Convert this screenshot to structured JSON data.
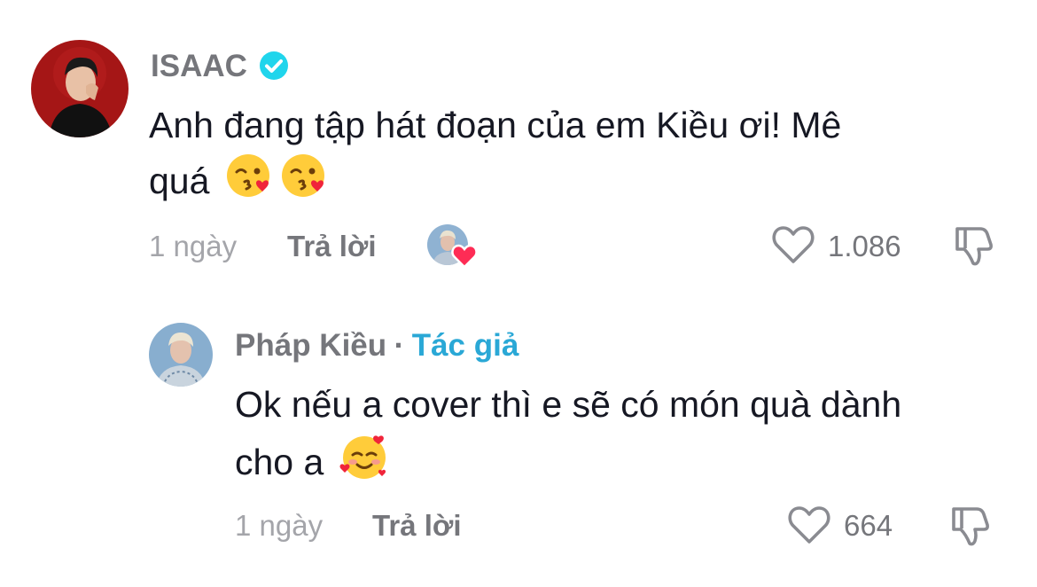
{
  "comments": [
    {
      "author": "ISAAC",
      "verified": true,
      "text_line1": "Anh đang tập hát đoạn của em Kiều ơi! Mê",
      "text_line2": "quá",
      "emojis": [
        "kissing-heart-emoji",
        "kissing-heart-emoji"
      ],
      "time": "1 ngày",
      "reply_label": "Trả lời",
      "liked_by_creator": true,
      "likes": "1.086"
    },
    {
      "author": "Pháp Kiều",
      "separator": "·",
      "author_tag": "Tác giả",
      "text_line1": "Ok nếu a cover thì e sẽ có món quà dành",
      "text_line2": "cho a",
      "emojis": [
        "smiling-hearts-emoji"
      ],
      "time": "1 ngày",
      "reply_label": "Trả lời",
      "likes": "664"
    }
  ],
  "colors": {
    "verified_badge": "#20d5ec",
    "author_tag": "#2aa8d6",
    "heart_badge": "#fe2c55"
  }
}
